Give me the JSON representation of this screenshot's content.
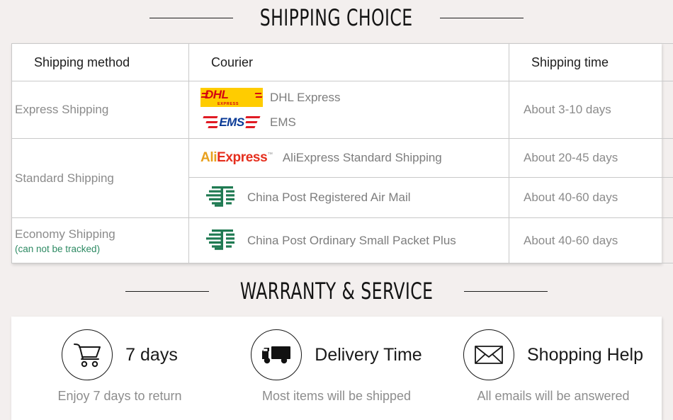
{
  "sections": {
    "shipping_title": "SHIPPING CHOICE",
    "warranty_title": "WARRANTY & SERVICE"
  },
  "shipping_table": {
    "headers": {
      "method": "Shipping method",
      "courier": "Courier",
      "time": "Shipping time"
    },
    "rows": [
      {
        "method": "Express Shipping",
        "method_note": "",
        "couriers": [
          {
            "logo": "dhl-logo",
            "name": "DHL Express"
          },
          {
            "logo": "ems-logo",
            "name": "EMS"
          }
        ],
        "time": "About 3-10 days"
      },
      {
        "method": "Standard Shipping",
        "method_note": "",
        "couriers": [
          {
            "logo": "aliexpress-logo",
            "name": "AliExpress Standard Shipping"
          }
        ],
        "time": "About 20-45 days"
      },
      {
        "method": "",
        "method_note": "",
        "couriers": [
          {
            "logo": "china-post-logo",
            "name": "China Post Registered Air Mail"
          }
        ],
        "time": "About 40-60 days"
      },
      {
        "method": "Economy Shipping",
        "method_note": "(can not be tracked)",
        "couriers": [
          {
            "logo": "china-post-logo",
            "name": "China Post Ordinary Small Packet Plus"
          }
        ],
        "time": "About 40-60 days"
      }
    ]
  },
  "services": [
    {
      "icon": "shopping-cart-icon",
      "title": "7 days",
      "caption": "Enjoy 7 days to return"
    },
    {
      "icon": "delivery-truck-icon",
      "title": "Delivery Time",
      "caption": "Most items will be shipped"
    },
    {
      "icon": "envelope-icon",
      "title": "Shopping Help",
      "caption": "All emails will be answered"
    }
  ],
  "brand_colors": {
    "dhl_yellow": "#ffcc00",
    "dhl_red": "#d40511",
    "ems_blue": "#0a3a96",
    "ems_red": "#e01b24",
    "ali_orange": "#e8a01d",
    "ali_red": "#e52e1d",
    "china_post_green": "#1f7a52",
    "note_green": "#2d8a63",
    "page_background": "#f3efee"
  },
  "logo_text": {
    "dhl_word": "DHL",
    "dhl_sub": "EXPRESS",
    "ems_word": "EMS",
    "ali_first": "Ali",
    "ali_second": "Express",
    "ali_tm": "™"
  }
}
